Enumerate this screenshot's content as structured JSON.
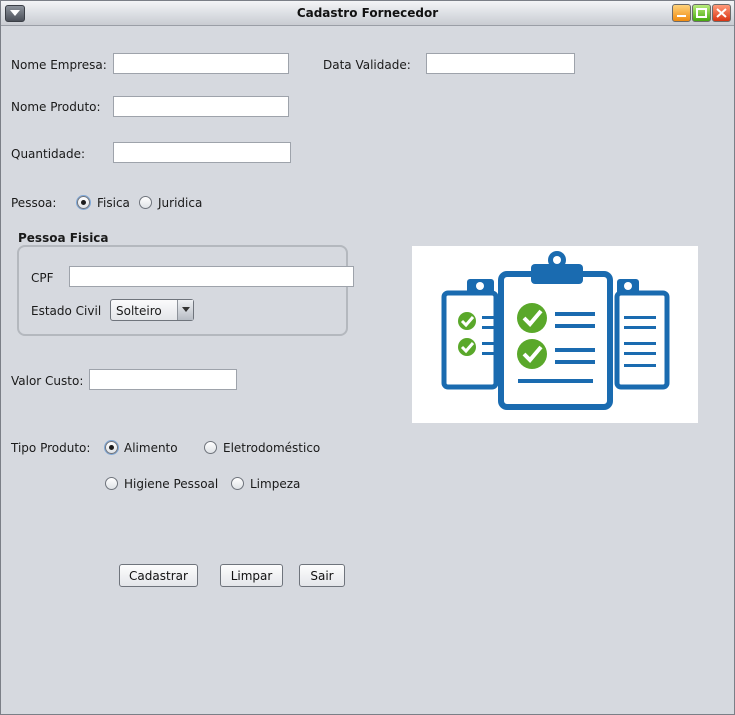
{
  "window": {
    "title": "Cadastro Fornecedor"
  },
  "form": {
    "nome_empresa": {
      "label": "Nome Empresa:",
      "value": ""
    },
    "data_validade": {
      "label": "Data Validade:",
      "value": ""
    },
    "nome_produto": {
      "label": "Nome Produto:",
      "value": ""
    },
    "quantidade": {
      "label": "Quantidade:",
      "value": ""
    },
    "pessoa": {
      "label": "Pessoa:",
      "options": [
        {
          "label": "Fisica",
          "selected": true
        },
        {
          "label": "Juridica",
          "selected": false
        }
      ]
    },
    "pessoa_fisica": {
      "title": "Pessoa Fisica",
      "cpf": {
        "label": "CPF",
        "value": ""
      },
      "estado_civil": {
        "label": "Estado Civil",
        "selected": "Solteiro"
      }
    },
    "valor_custo": {
      "label": "Valor Custo:",
      "value": ""
    },
    "tipo_produto": {
      "label": "Tipo Produto:",
      "options": [
        {
          "label": "Alimento",
          "selected": true
        },
        {
          "label": "Eletrodoméstico",
          "selected": false
        },
        {
          "label": "Higiene Pessoal",
          "selected": false
        },
        {
          "label": "Limpeza",
          "selected": false
        }
      ]
    }
  },
  "buttons": {
    "cadastrar": "Cadastrar",
    "limpar": "Limpar",
    "sair": "Sair"
  },
  "icons": {
    "window_menu": "chevron-down-icon",
    "minimize": "minimize-icon",
    "maximize": "maximize-icon",
    "close": "close-icon",
    "illustration": "clipboard-checklist-icon"
  },
  "colors": {
    "illustration_blue": "#1a6bb0",
    "illustration_green": "#5aa82a"
  }
}
